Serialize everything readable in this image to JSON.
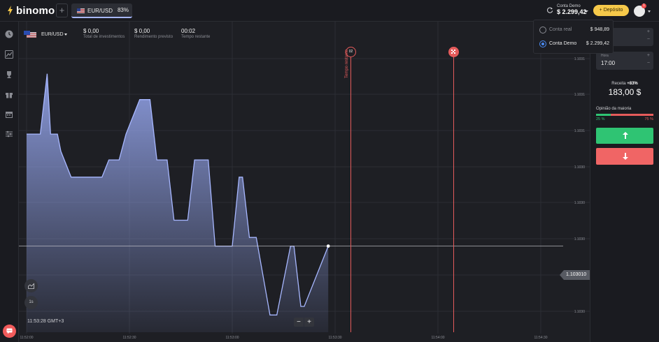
{
  "header": {
    "logo_text": "binomo",
    "add_tab_label": "+",
    "asset_tab": {
      "name": "EUR/USD",
      "payout": "83%"
    },
    "account": {
      "label": "Conta Demo",
      "balance": "$ 2.299,42"
    },
    "deposit_label": "Depósito",
    "notification_count": "1"
  },
  "account_menu": {
    "items": [
      {
        "name": "Conta real",
        "amount": "$ 948,89",
        "selected": false
      },
      {
        "name": "Conta Demo",
        "amount": "$ 2.299,42",
        "selected": true
      }
    ]
  },
  "asset_header": {
    "name": "EUR/USD",
    "stats": [
      {
        "value": "$ 0,00",
        "label": "Total de investimentos"
      },
      {
        "value": "$ 0,00",
        "label": "Rendimento previsto"
      },
      {
        "value": "00:02",
        "label": "Tempo restante"
      }
    ]
  },
  "chart_data": {
    "type": "area",
    "symbol": "EUR/USD",
    "current_price": "1.103010",
    "x_ticks": [
      "11:52:00",
      "11:52:30",
      "11:53:00",
      "11:53:30",
      "11:54:00",
      "11:54:30"
    ],
    "y_ticks": [
      "1.1031",
      "1.1031",
      "1.1031",
      "1.1030",
      "1.1030",
      "1.1030",
      "1.1030",
      "1.1030"
    ],
    "x": [
      "11:52:00",
      "11:52:04",
      "11:52:06",
      "11:52:07",
      "11:52:09",
      "11:52:10",
      "11:52:13",
      "11:52:15",
      "11:52:22",
      "11:52:24",
      "11:52:27",
      "11:52:29",
      "11:52:33",
      "11:52:34",
      "11:52:36",
      "11:52:38",
      "11:52:41",
      "11:52:43",
      "11:52:47",
      "11:52:49",
      "11:52:53",
      "11:52:55",
      "11:53:00",
      "11:53:02",
      "11:53:03",
      "11:53:05",
      "11:53:07",
      "11:53:11",
      "11:53:13",
      "11:53:17",
      "11:53:18",
      "11:53:20",
      "11:53:21",
      "11:53:28"
    ],
    "values": [
      1.10316,
      1.10316,
      1.1033,
      1.10316,
      1.10316,
      1.10312,
      1.10306,
      1.10306,
      1.10306,
      1.1031,
      1.1031,
      1.10316,
      1.10324,
      1.10324,
      1.10324,
      1.1031,
      1.1031,
      1.10296,
      1.10296,
      1.1031,
      1.1031,
      1.1029,
      1.1029,
      1.10306,
      1.10306,
      1.10292,
      1.10292,
      1.10274,
      1.10274,
      1.1029,
      1.1029,
      1.10276,
      1.10276,
      1.1029
    ],
    "ylim": [
      1.1027,
      1.10334
    ],
    "timer_label": "02",
    "expiry_label": "Tempo restante",
    "time_display": "11:53:28 GMT+3",
    "interval_label": "1s",
    "zoom_out_label": "−",
    "zoom_in_label": "+",
    "colors": {
      "line": "#a7b7ff",
      "fill_top": "#8f9fe3",
      "marker": "#e45b5b"
    }
  },
  "trade_panel": {
    "amount_field": {
      "plus": "+",
      "minus": "−"
    },
    "time_field": {
      "label": "Hora",
      "value": "17:00",
      "plus": "+",
      "minus": "−"
    },
    "receita_label": "Receita",
    "receita_pct": "+83%",
    "receita_value": "183,00 $",
    "opinion_title": "Opinião da maioria",
    "opinion_up": "25 %",
    "opinion_down": "75 %",
    "opinion_up_fraction": 0.25,
    "colors": {
      "up": "#2fc473",
      "down": "#f06565"
    }
  }
}
